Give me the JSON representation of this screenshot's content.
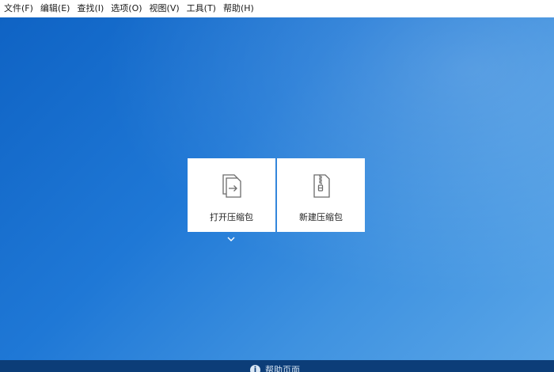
{
  "menu": {
    "items": [
      {
        "label": "文件(F)"
      },
      {
        "label": "编辑(E)"
      },
      {
        "label": "查找(I)"
      },
      {
        "label": "选项(O)"
      },
      {
        "label": "视图(V)"
      },
      {
        "label": "工具(T)"
      },
      {
        "label": "帮助(H)"
      }
    ]
  },
  "actions": {
    "open_archive": {
      "label": "打开压缩包",
      "icon": "open-archive-icon"
    },
    "new_archive": {
      "label": "新建压缩包",
      "icon": "new-archive-icon"
    }
  },
  "statusbar": {
    "help_label": "帮助页面",
    "help_icon": "info-icon"
  },
  "colors": {
    "background_blue": "#1f78d6",
    "statusbar_blue": "#0c3d78",
    "card_white": "#ffffff"
  }
}
